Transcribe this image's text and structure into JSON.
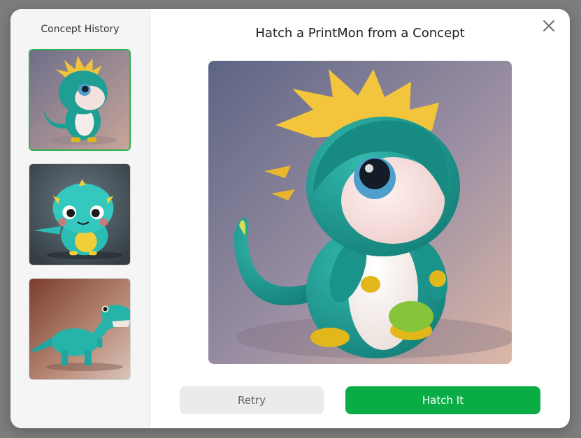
{
  "sidebar": {
    "title": "Concept History",
    "items": [
      {
        "name": "concept-1",
        "selected": true
      },
      {
        "name": "concept-2",
        "selected": false
      },
      {
        "name": "concept-3",
        "selected": false
      }
    ]
  },
  "header": {
    "title": "Hatch a PrintMon from a Concept",
    "close_icon": "close-icon"
  },
  "actions": {
    "retry_label": "Retry",
    "hatch_label": "Hatch It"
  },
  "colors": {
    "accent": "#0aad45",
    "selected_border": "#2bb24c",
    "creature_teal": "#1f9e94",
    "spikes": "#f2c53d"
  }
}
